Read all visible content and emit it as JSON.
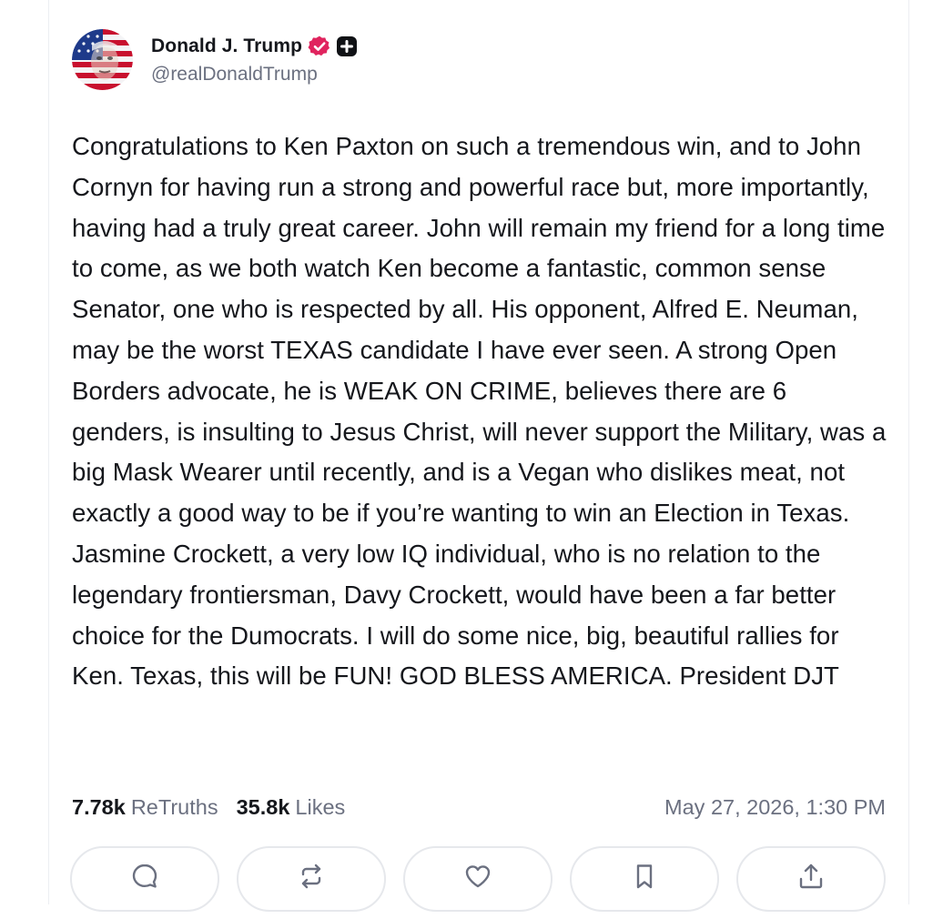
{
  "post": {
    "author": {
      "display_name": "Donald J. Trump",
      "handle": "@realDonaldTrump",
      "avatar_icon": "flag-face-avatar",
      "verified_icon": "verified-badge-icon",
      "verified_color": "#e0245e",
      "plus_icon": "plus-badge-icon"
    },
    "text": "Congratulations to Ken Paxton on such a tremendous win, and to John Cornyn for having run a strong and powerful race but, more importantly, having had a truly great career. John will remain my friend for a long time to come, as we both watch Ken become a fantastic, common sense Senator, one who is respected by all. His opponent, Alfred E. Neuman, may be the worst TEXAS candidate I have ever seen. A strong Open Borders advocate, he is WEAK ON CRIME, believes there are 6 genders, is insulting to Jesus Christ, will never support the Military, was a big Mask Wearer until recently, and is a Vegan who dislikes meat, not exactly a good way to be if you’re wanting to win an Election in Texas. Jasmine Crockett, a very low IQ individual, who is no relation to the legendary frontiersman, Davy Crockett, would have been a far better choice for the Dumocrats. I will do some nice, big, beautiful rallies for Ken. Texas, this will be FUN! GOD BLESS AMERICA. President DJT",
    "stats": {
      "retruths_count": "7.78k",
      "retruths_label": "ReTruths",
      "likes_count": "35.8k",
      "likes_label": "Likes"
    },
    "timestamp": "May 27, 2026, 1:30 PM"
  },
  "actions": [
    {
      "name": "reply",
      "icon": "reply-icon"
    },
    {
      "name": "retruth",
      "icon": "retruth-icon"
    },
    {
      "name": "like",
      "icon": "heart-icon"
    },
    {
      "name": "bookmark",
      "icon": "bookmark-icon"
    },
    {
      "name": "share",
      "icon": "share-icon"
    }
  ],
  "colors": {
    "text": "#15171c",
    "muted": "#6b7080",
    "border": "#e6e8ec",
    "icon": "#6b7080"
  }
}
